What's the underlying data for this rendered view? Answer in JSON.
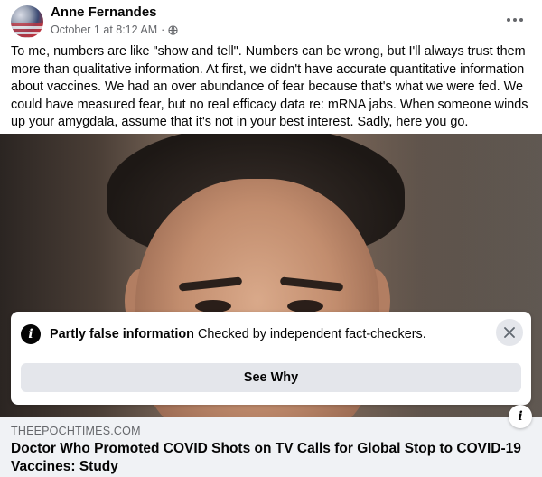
{
  "post": {
    "author": "Anne Fernandes",
    "timestamp": "October 1 at 8:12 AM",
    "separator": "·",
    "privacy_icon": "globe-icon",
    "more_icon": "ellipsis-icon",
    "text": "To me, numbers are like \"show and tell\".  Numbers can be wrong, but I'll always trust them more than qualitative information.  At first, we didn't have accurate quantitative information about vaccines.  We had an over abundance of fear because that's what we were fed.  We could have measured fear, but no real efficacy data re: mRNA jabs.  When someone winds up your amygdala, assume that it's not in your best interest.  Sadly, here you go."
  },
  "fact_check": {
    "icon": "info-icon",
    "label_bold": "Partly false information",
    "label_rest": "Checked by independent fact-checkers.",
    "close_icon": "close-icon",
    "button_label": "See Why"
  },
  "link": {
    "info_badge": "i",
    "domain": "THEEPOCHTIMES.COM",
    "title": "Doctor Who Promoted COVID Shots on TV Calls for Global Stop to COVID-19 Vaccines: Study"
  },
  "colors": {
    "text_primary": "#050505",
    "text_secondary": "#65676b",
    "button_bg": "#e4e6eb",
    "link_bg": "#f0f2f5"
  }
}
